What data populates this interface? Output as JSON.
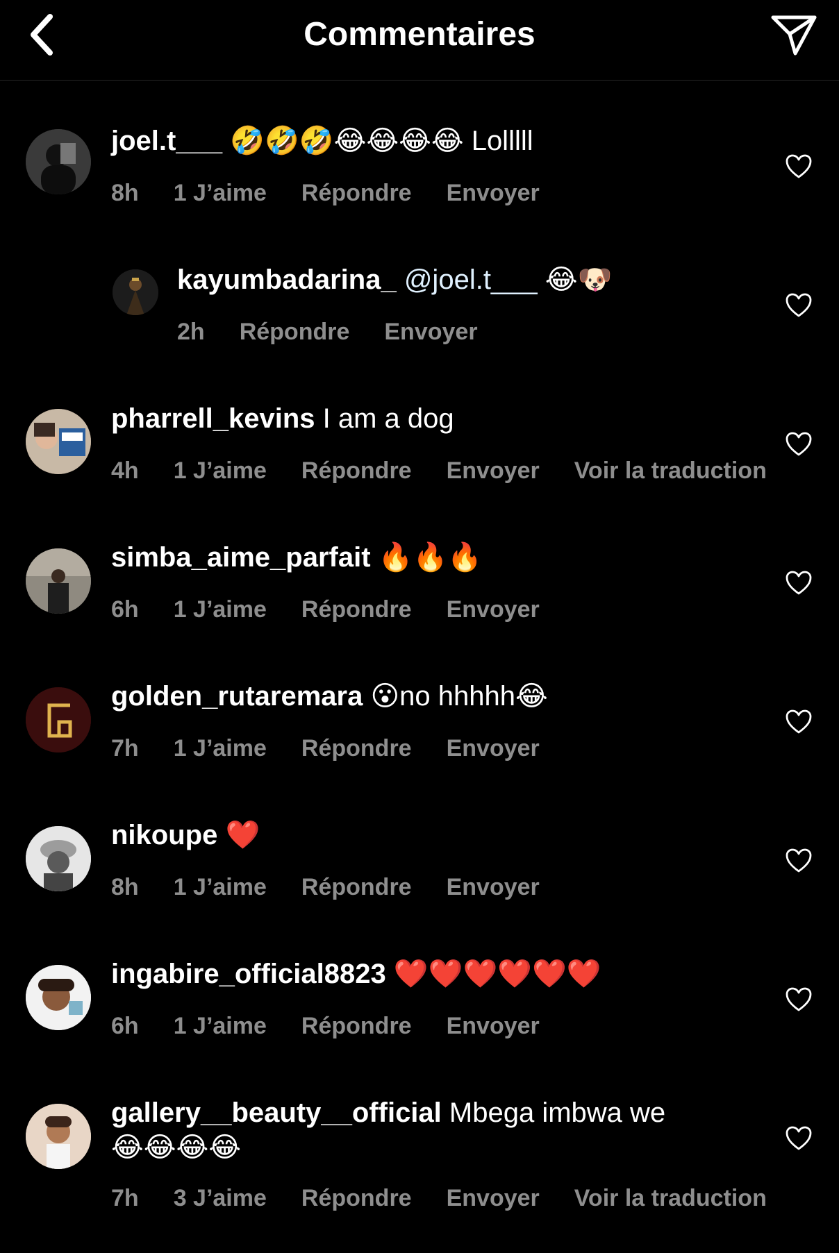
{
  "header": {
    "title": "Commentaires",
    "back_icon": "chevron-left-icon",
    "send_icon": "paper-plane-icon"
  },
  "colors": {
    "background": "#000000",
    "text": "#ffffff",
    "meta": "#8e8e8e",
    "divider": "#262626"
  },
  "comments": [
    {
      "username": "joel.t___",
      "emoji": "🤣🤣🤣😂😂😂😂",
      "text": " Lolllll",
      "time": "8h",
      "likes": "1 J’aime",
      "reply": "Répondre",
      "send": "Envoyer",
      "translate": ""
    },
    {
      "username": "kayumbadarina_",
      "mention": "@joel.t___",
      "emoji": "😂🐶",
      "text": "",
      "time": "2h",
      "likes": "",
      "reply": "Répondre",
      "send": "Envoyer",
      "translate": ""
    },
    {
      "username": "pharrell_kevins",
      "emoji": "",
      "text": "I am a dog",
      "time": "4h",
      "likes": "1 J’aime",
      "reply": "Répondre",
      "send": "Envoyer",
      "translate": "Voir la traduction"
    },
    {
      "username": "simba_aime_parfait",
      "emoji": "🔥🔥🔥",
      "text": "",
      "time": "6h",
      "likes": "1 J’aime",
      "reply": "Répondre",
      "send": "Envoyer",
      "translate": ""
    },
    {
      "username": "golden_rutaremara",
      "emoji": "😮",
      "text": "no hhhhh",
      "emoji2": "😂",
      "time": "7h",
      "likes": "1 J’aime",
      "reply": "Répondre",
      "send": "Envoyer",
      "translate": ""
    },
    {
      "username": "nikoupe",
      "emoji": "❤️",
      "text": "",
      "time": "8h",
      "likes": "1 J’aime",
      "reply": "Répondre",
      "send": "Envoyer",
      "translate": ""
    },
    {
      "username": "ingabire_official8823",
      "emoji": "❤️❤️❤️❤️❤️❤️",
      "text": "",
      "time": "6h",
      "likes": "1 J’aime",
      "reply": "Répondre",
      "send": "Envoyer",
      "translate": ""
    },
    {
      "username": "gallery__beauty__official",
      "emoji": "",
      "text": "Mbega imbwa we",
      "emoji_line2": "😂😂😂😂",
      "time": "7h",
      "likes": "3 J’aime",
      "reply": "Répondre",
      "send": "Envoyer",
      "translate": "Voir la traduction"
    }
  ]
}
